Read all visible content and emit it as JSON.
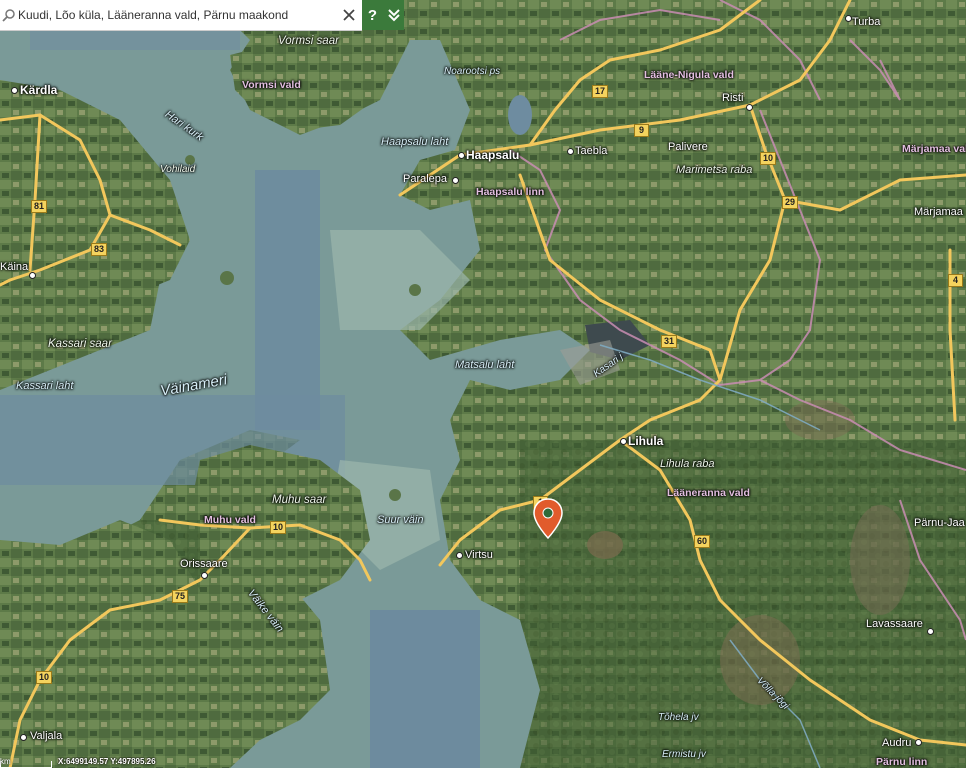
{
  "search": {
    "value": "Kuudi, Lõo küla, Lääneranna vald, Pärnu maakond"
  },
  "buttons": {
    "help_label": "?",
    "expand_label": "⌄⌄"
  },
  "icons": {
    "search": "search-icon",
    "close": "close-icon",
    "marker": "location-pin-icon"
  },
  "colors": {
    "marker": "#e15b2c",
    "road": "#f2c75c",
    "admin_border": "#c98db3",
    "tool_green": "#3b7a3b"
  },
  "labels": {
    "settlements": {
      "kardla": "Kärdla",
      "haapsalu": "Haapsalu",
      "lihula": "Lihula",
      "taebla": "Taebla",
      "paralepa": "Paralepa",
      "kaina": "Käina",
      "risti": "Risti",
      "palivere": "Palivere",
      "virtsu": "Virtsu",
      "orissaare": "Orissaare",
      "valjala": "Valjala",
      "turba": "Turba",
      "marjamaa": "Märjamaa",
      "parnu_jaagupi": "Pärnu-Jaa",
      "lavassaare": "Lavassaare",
      "audru": "Audru"
    },
    "admin": {
      "vormsi_vald": "Vormsi vald",
      "laane_nigula_vald": "Lääne-Nigula vald",
      "haapsalu_linn": "Haapsalu linn",
      "marjamaa_vald": "Märjamaa vald",
      "laaneranna_vald": "Lääneranna vald",
      "muhu_vald": "Muhu vald",
      "parnu_linn": "Pärnu linn"
    },
    "water": {
      "vainameri": "Väinameri",
      "haapsalu_laht": "Haapsalu laht",
      "matsalu_laht": "Matsalu laht",
      "kassari_laht": "Kassari laht",
      "suur_vain": "Suur väin",
      "vaike_vain": "Väike väin",
      "hari_kurk": "Hari kurk",
      "noarootsi_ps": "Noarootsi ps",
      "kasari_j": "Kasari j",
      "volla_jogi": "Võlla jõgi",
      "tohela_jv": "Tõhela jv",
      "ermistu_jv": "Ermistu jv"
    },
    "islands": {
      "vormsi_saar": "Vormsi saar",
      "kassari_saar": "Kassari saar",
      "muhu_saar": "Muhu saar",
      "vohilaid": "Vohilaid"
    },
    "nature": {
      "marimetsa_raba": "Marimetsa raba",
      "lihula_raba": "Lihula raba"
    },
    "roads": {
      "r17": "17",
      "r9": "9",
      "r10a": "10",
      "r29": "29",
      "r4": "4",
      "r81": "81",
      "r83": "83",
      "r31": "31",
      "r10b": "10",
      "r60": "60",
      "r75": "75",
      "r10c": "10",
      "r1": "1"
    }
  },
  "status": {
    "coordinates": "X:6499149.57 Y:497895.26",
    "scale": "km"
  }
}
